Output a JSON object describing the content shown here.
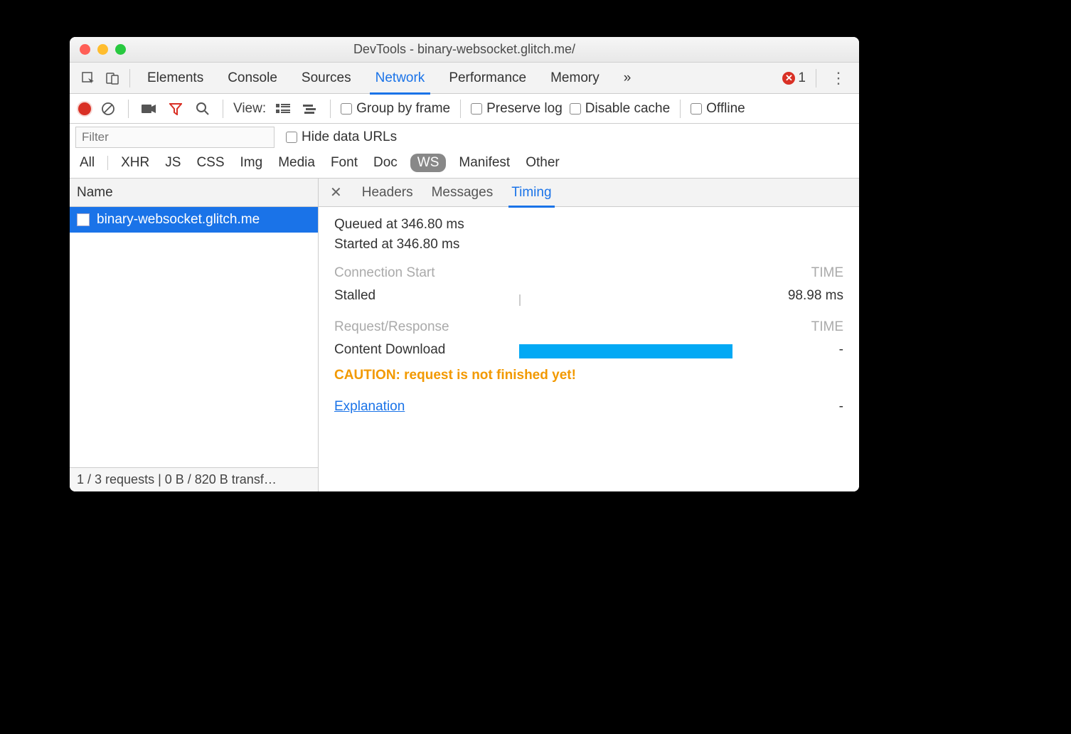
{
  "window": {
    "title": "DevTools - binary-websocket.glitch.me/"
  },
  "mainTabs": {
    "items": [
      "Elements",
      "Console",
      "Sources",
      "Network",
      "Performance",
      "Memory"
    ],
    "overflow": "»",
    "active": "Network",
    "errorCount": "1"
  },
  "netToolbar": {
    "viewLabel": "View:",
    "groupByFrame": "Group by frame",
    "preserveLog": "Preserve log",
    "disableCache": "Disable cache",
    "offline": "Offline"
  },
  "filter": {
    "placeholder": "Filter",
    "hideDataUrls": "Hide data URLs"
  },
  "typeFilters": {
    "items": [
      "All",
      "XHR",
      "JS",
      "CSS",
      "Img",
      "Media",
      "Font",
      "Doc",
      "WS",
      "Manifest",
      "Other"
    ],
    "active": "WS"
  },
  "leftPane": {
    "header": "Name",
    "request": "binary-websocket.glitch.me",
    "status": "1 / 3 requests | 0 B / 820 B transf…"
  },
  "detailTabs": {
    "items": [
      "Headers",
      "Messages",
      "Timing"
    ],
    "active": "Timing"
  },
  "timing": {
    "queued": "Queued at 346.80 ms",
    "started": "Started at 346.80 ms",
    "sectionConn": "Connection Start",
    "sectionReq": "Request/Response",
    "timeHeader": "TIME",
    "stalledLabel": "Stalled",
    "stalledValue": "98.98 ms",
    "downloadLabel": "Content Download",
    "downloadValue": "-",
    "caution": "CAUTION: request is not finished yet!",
    "explanation": "Explanation",
    "explanationValue": "-"
  }
}
